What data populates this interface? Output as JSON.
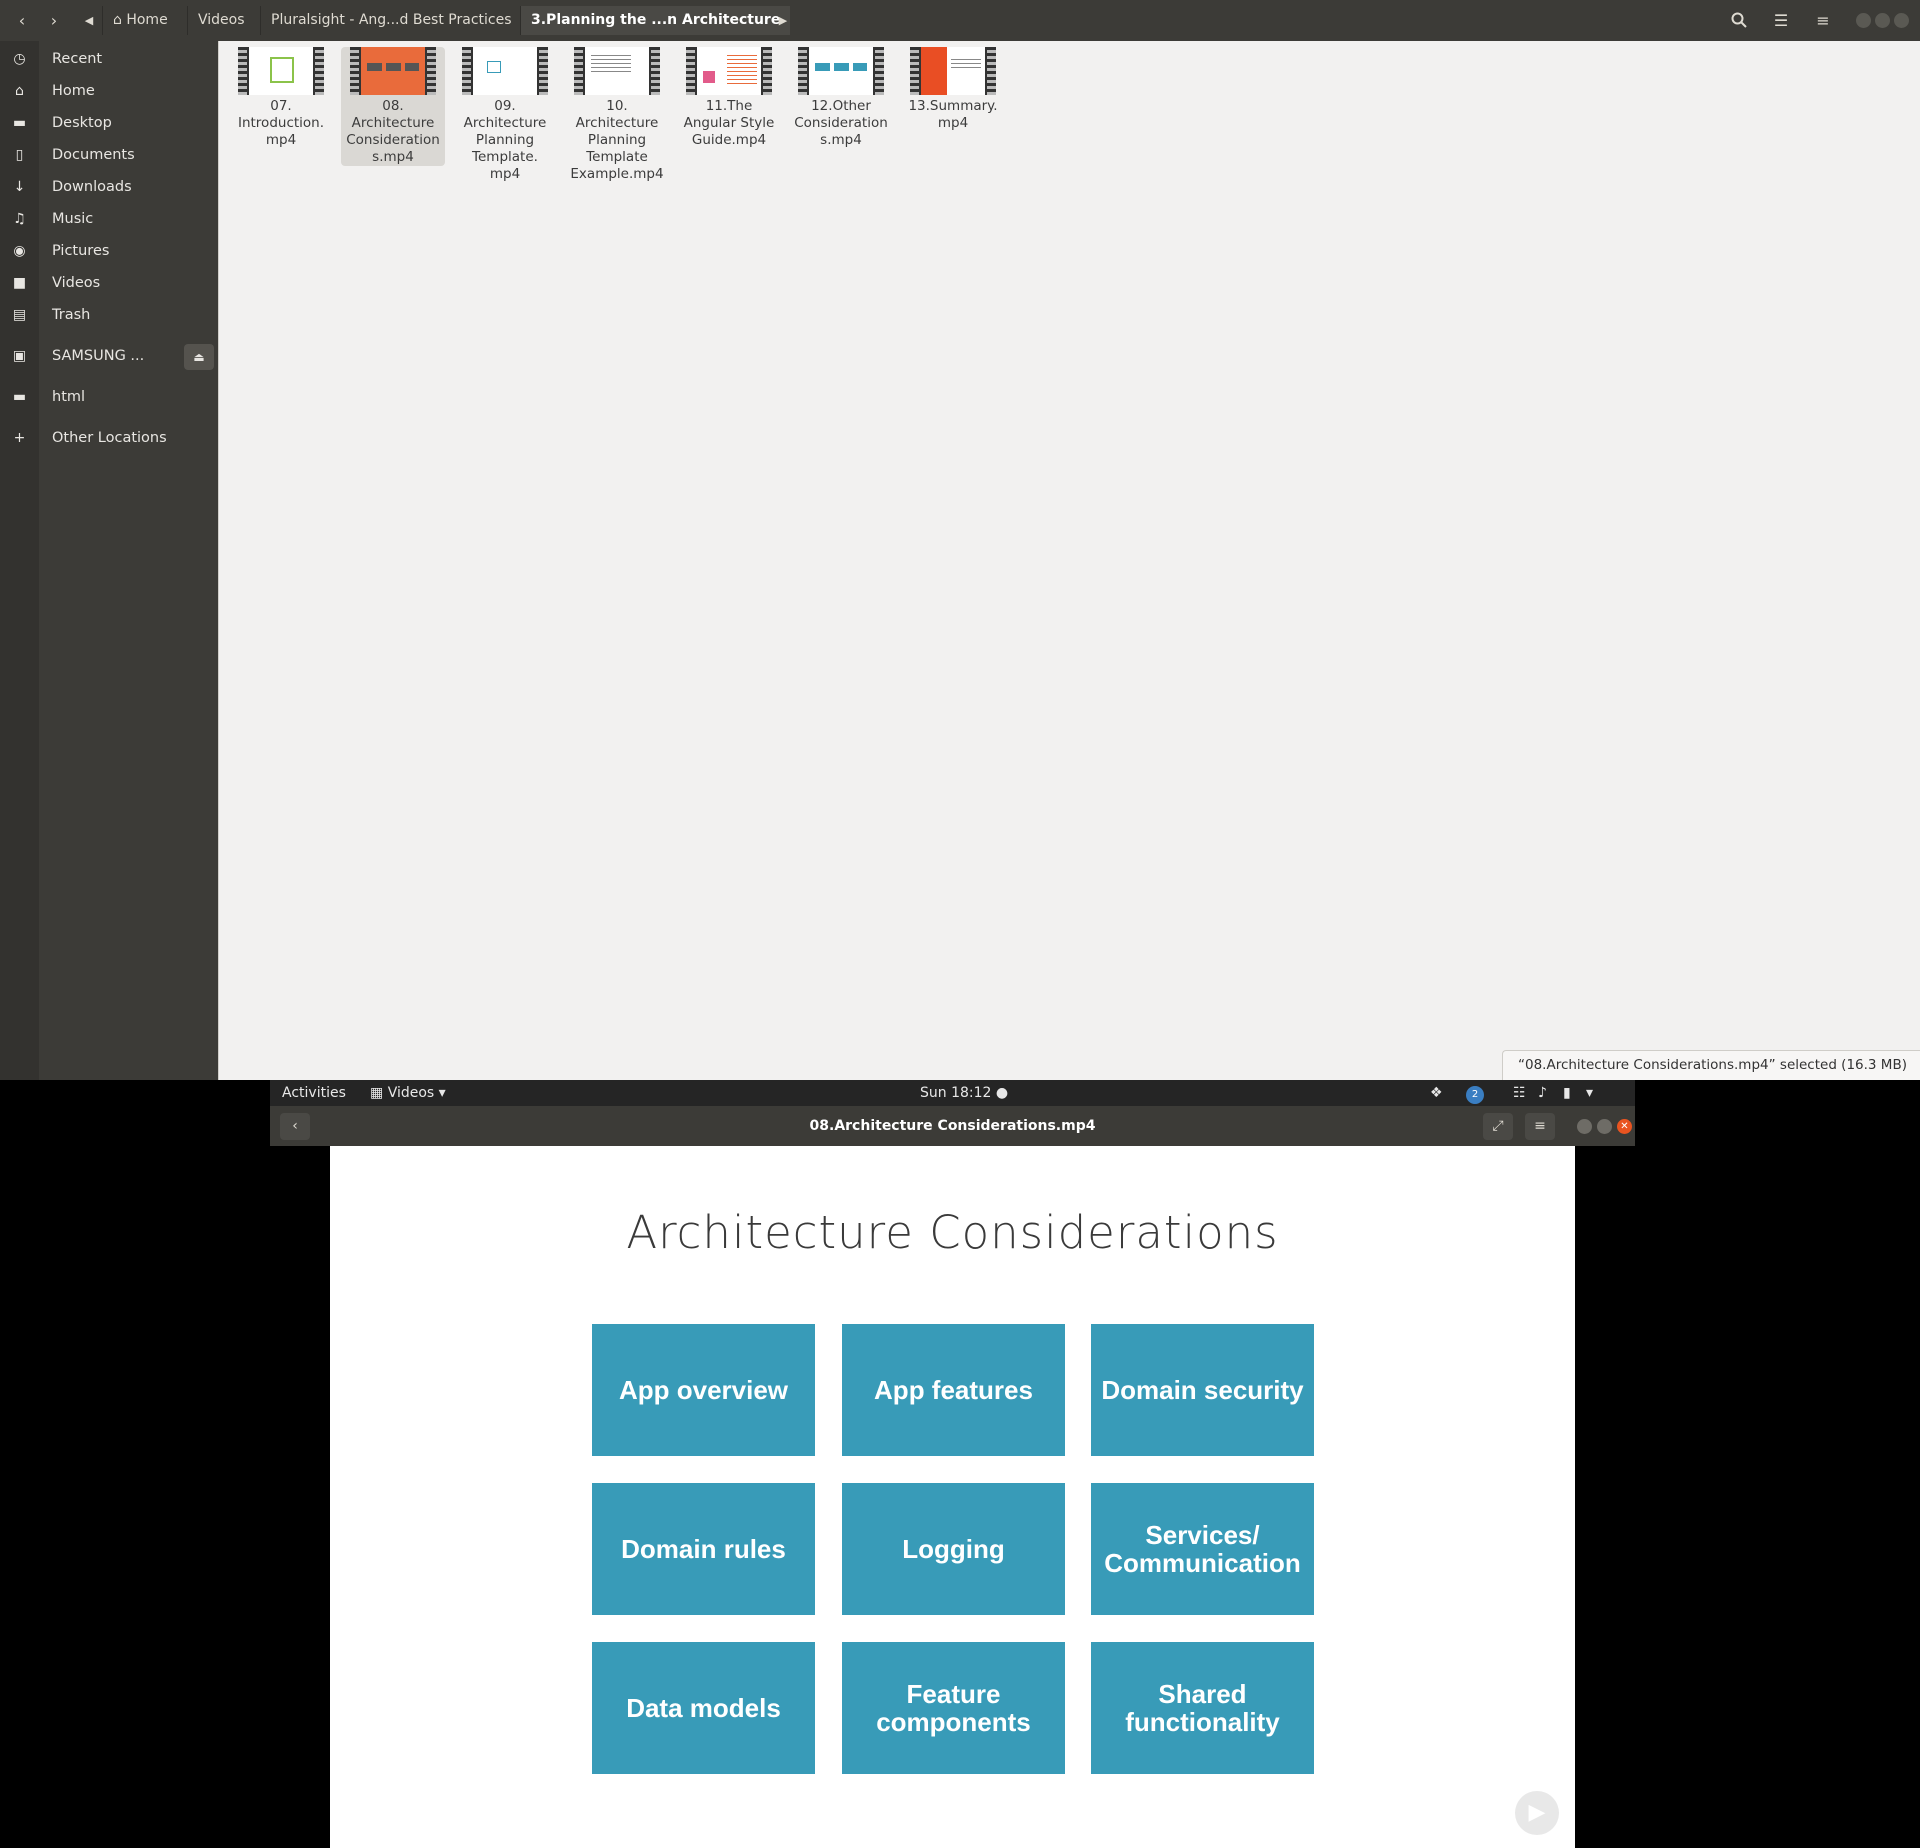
{
  "file_manager": {
    "breadcrumbs": [
      {
        "label": "Home"
      },
      {
        "label": "Videos"
      },
      {
        "label": "Pluralsight - Ang...d Best Practices"
      },
      {
        "label": "3.Planning the ...n Architecture"
      }
    ],
    "sidebar": [
      {
        "label": "Recent",
        "icon": "recent-icon"
      },
      {
        "label": "Home",
        "icon": "home-icon"
      },
      {
        "label": "Desktop",
        "icon": "folder-icon"
      },
      {
        "label": "Documents",
        "icon": "document-icon"
      },
      {
        "label": "Downloads",
        "icon": "download-icon"
      },
      {
        "label": "Music",
        "icon": "music-icon"
      },
      {
        "label": "Pictures",
        "icon": "camera-icon"
      },
      {
        "label": "Videos",
        "icon": "video-icon"
      },
      {
        "label": "Trash",
        "icon": "trash-icon"
      },
      {
        "label": "SAMSUNG ...",
        "icon": "drive-icon"
      },
      {
        "label": "html",
        "icon": "folder-icon"
      },
      {
        "label": "Other Locations",
        "icon": "plus-icon"
      }
    ],
    "files": [
      {
        "name": "07.\nIntroduction.\nmp4"
      },
      {
        "name": "08.\nArchitecture\nConsideration\ns.mp4",
        "selected": true
      },
      {
        "name": "09.\nArchitecture\nPlanning\nTemplate.\nmp4"
      },
      {
        "name": "10.\nArchitecture\nPlanning\nTemplate\nExample.mp4"
      },
      {
        "name": "11.The\nAngular Style\nGuide.mp4"
      },
      {
        "name": "12.Other\nConsideration\ns.mp4"
      },
      {
        "name": "13.Summary.\nmp4"
      }
    ],
    "status": "“08.Architecture Considerations.mp4” selected  (16.3 MB)"
  },
  "topbar": {
    "activities": "Activities",
    "app_menu": "Videos",
    "clock": "Sun 18:12",
    "notification_count": "2"
  },
  "video": {
    "title": "08.Architecture Considerations.mp4",
    "slide_title": "Architecture Considerations",
    "tiles": [
      "App overview",
      "App features",
      "Domain security",
      "Domain rules",
      "Logging",
      "Services/ Communication",
      "Data models",
      "Feature components",
      "Shared functionality"
    ],
    "tile_color": "#389bb8"
  }
}
